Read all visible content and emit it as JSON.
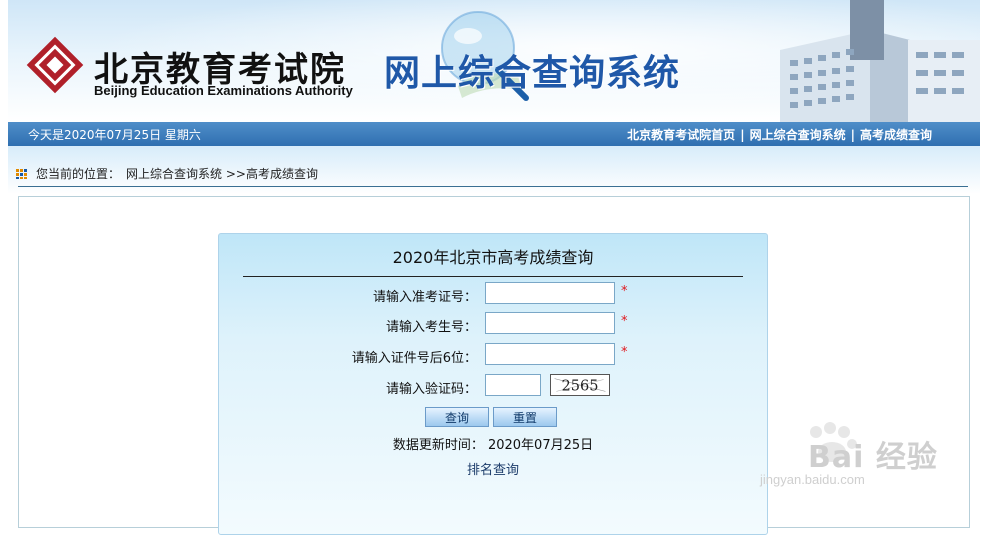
{
  "header": {
    "org_name_cn": "北京教育考试院",
    "org_name_en": "Beijing Education Examinations Authority",
    "system_title": "网上综合查询系统"
  },
  "navbar": {
    "date_text": "今天是2020年07月25日  星期六",
    "links": [
      "北京教育考试院首页",
      "网上综合查询系统",
      "高考成绩查询"
    ],
    "separator": "|"
  },
  "breadcrumb": {
    "prefix": "您当前的位置：",
    "path": "网上综合查询系统 >>高考成绩查询"
  },
  "form": {
    "title": "2020年北京市高考成绩查询",
    "fields": [
      {
        "label": "请输入准考证号：",
        "value": "",
        "required": "*"
      },
      {
        "label": "请输入考生号：",
        "value": "",
        "required": "*"
      },
      {
        "label": "请输入证件号后6位：",
        "value": "",
        "required": "*"
      },
      {
        "label": "请输入验证码：",
        "value": ""
      }
    ],
    "captcha_text": "2565",
    "query_button": "查询",
    "reset_button": "重置",
    "update_text": "数据更新时间： 2020年07月25日",
    "rank_link": "排名查询"
  },
  "watermark": {
    "brand": "Bai 经验",
    "sub": "jingyan.baidu.com"
  },
  "colors": {
    "nav_blue": "#2f6fb0",
    "title_blue": "#1f58a8",
    "required_red": "#e0161b",
    "logo_red": "#b0202a"
  }
}
